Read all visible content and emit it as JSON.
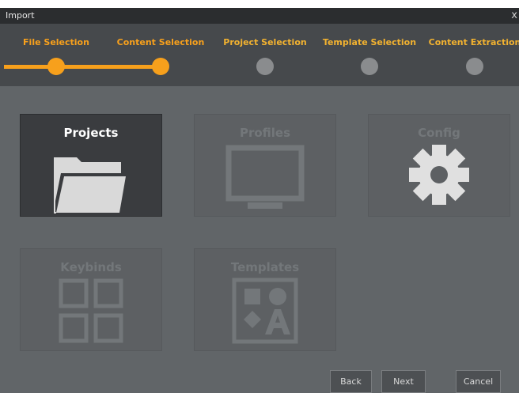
{
  "window": {
    "title": "Import",
    "close_glyph": "x"
  },
  "wizard": {
    "steps": [
      {
        "label": "File Selection",
        "state": "done"
      },
      {
        "label": "Content Selection",
        "state": "current"
      },
      {
        "label": "Project Selection",
        "state": "pending"
      },
      {
        "label": "Template Selection",
        "state": "pending"
      },
      {
        "label": "Content Extraction",
        "state": "pending"
      }
    ],
    "accent_color": "#f7a01c",
    "pending_color": "#8a8c8e"
  },
  "tiles": [
    {
      "label": "Projects",
      "icon": "folder-icon",
      "selected": true
    },
    {
      "label": "Profiles",
      "icon": "monitor-icon",
      "selected": false
    },
    {
      "label": "Config",
      "icon": "gear-icon",
      "selected": false
    },
    {
      "label": "Keybinds",
      "icon": "grid-icon",
      "selected": false
    },
    {
      "label": "Templates",
      "icon": "shapes-icon",
      "selected": false
    }
  ],
  "buttons": {
    "back": "Back",
    "next": "Next",
    "cancel": "Cancel"
  }
}
